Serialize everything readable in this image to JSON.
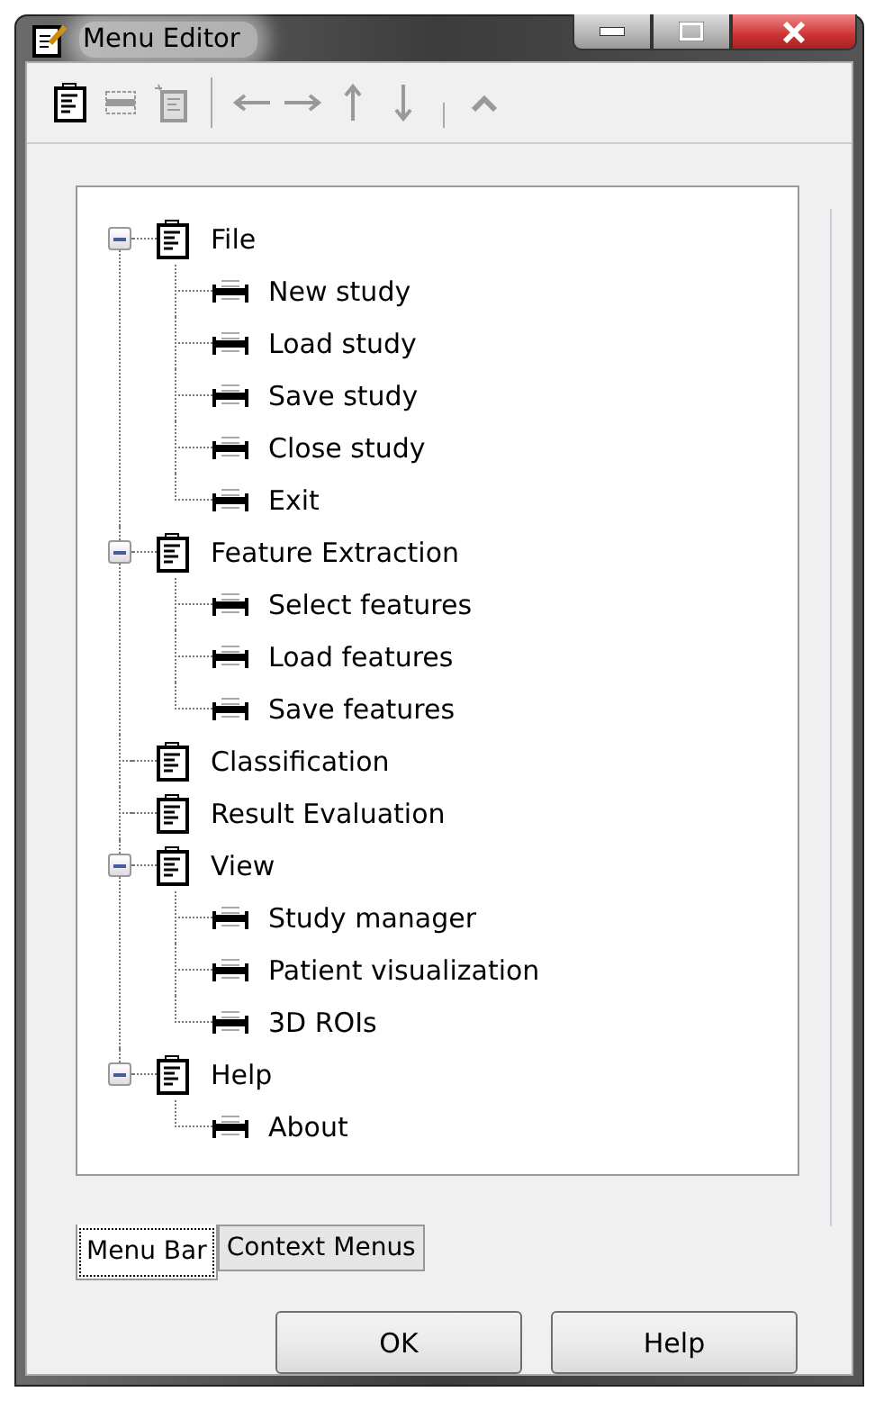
{
  "window": {
    "title": "Menu Editor"
  },
  "toolbar": [
    {
      "kind": "menu",
      "disabled": false
    },
    {
      "kind": "item",
      "disabled": true
    },
    {
      "kind": "new",
      "disabled": true
    },
    {
      "kind": "separator"
    },
    {
      "kind": "left",
      "disabled": true
    },
    {
      "kind": "right",
      "disabled": true
    },
    {
      "kind": "up",
      "disabled": true
    },
    {
      "kind": "down",
      "disabled": true
    },
    {
      "kind": "separator"
    },
    {
      "kind": "caret",
      "disabled": true
    }
  ],
  "tree": [
    {
      "label": "File",
      "expanded": true,
      "children": [
        {
          "label": "New study"
        },
        {
          "label": "Load study"
        },
        {
          "label": "Save study"
        },
        {
          "label": "Close study"
        },
        {
          "label": "Exit"
        }
      ]
    },
    {
      "label": "Feature Extraction",
      "expanded": true,
      "children": [
        {
          "label": "Select features"
        },
        {
          "label": "Load features"
        },
        {
          "label": "Save features"
        }
      ]
    },
    {
      "label": "Classification"
    },
    {
      "label": "Result Evaluation"
    },
    {
      "label": "View",
      "expanded": true,
      "children": [
        {
          "label": "Study manager"
        },
        {
          "label": "Patient visualization"
        },
        {
          "label": "3D ROIs"
        }
      ]
    },
    {
      "label": "Help",
      "expanded": true,
      "children": [
        {
          "label": "About"
        }
      ]
    }
  ],
  "tabs": [
    {
      "label": "Menu Bar",
      "selected": true
    },
    {
      "label": "Context Menus",
      "selected": false
    }
  ],
  "buttons": [
    "OK",
    "Help"
  ]
}
